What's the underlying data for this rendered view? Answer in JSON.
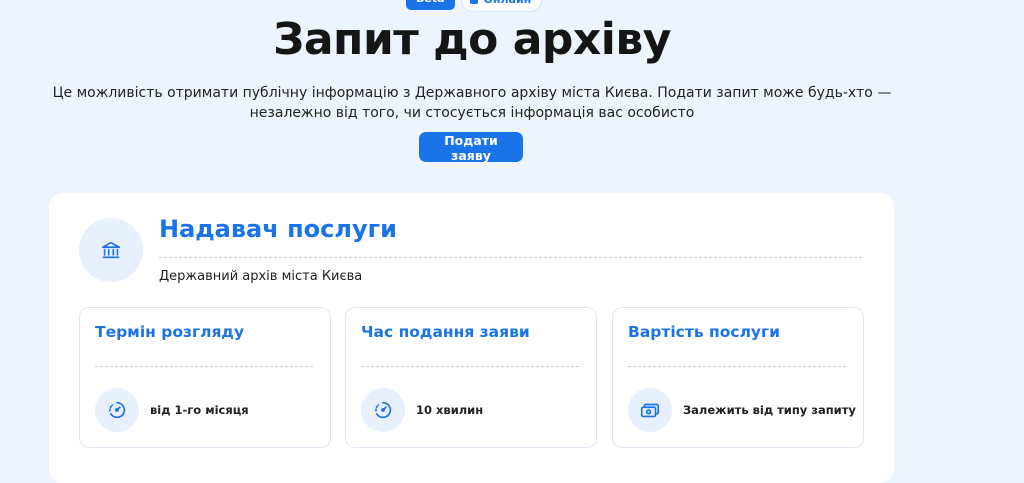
{
  "badges": {
    "beta": "Beta",
    "online": "Онлайн"
  },
  "title": "Запит до архіву",
  "description": "Це можливість отримати публічну інформацію з Державного архіву міста Києва. Подати запит може будь-хто — незалежно від того, чи стосується інформація вас особисто",
  "cta_label": "Подати заяву",
  "provider": {
    "heading": "Надавач послуги",
    "name": "Державний архів міста Києва",
    "icon": "bank-icon"
  },
  "info_cards": [
    {
      "title": "Термін розгляду",
      "value": "від 1-го місяця",
      "icon": "timer-icon"
    },
    {
      "title": "Час подання заяви",
      "value": "10 хвилин",
      "icon": "timer-icon"
    },
    {
      "title": "Вартість послуги",
      "value": "Залежить від типу запиту",
      "icon": "money-icon"
    }
  ],
  "colors": {
    "accent": "#1a73e8",
    "background": "#eef4fd",
    "icon_bg": "#e8f0fd"
  }
}
